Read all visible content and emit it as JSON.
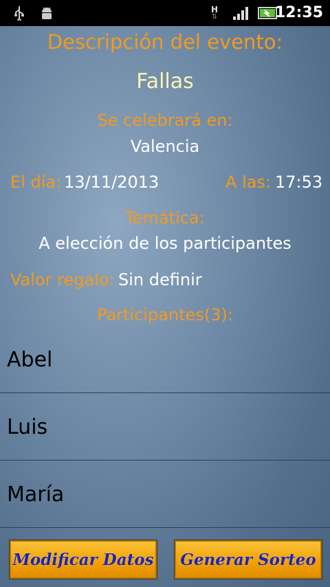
{
  "status_bar": {
    "time": "12:35",
    "network": "H",
    "icons": [
      "usb-icon",
      "android-debug-icon",
      "hspa-icon",
      "signal-icon",
      "battery-icon"
    ]
  },
  "event": {
    "heading": "Descripción del evento:",
    "name": "Fallas",
    "place_label": "Se celebrará en:",
    "place_value": "Valencia",
    "date_label": "El día:",
    "date_value": "13/11/2013",
    "time_label": "A las:",
    "time_value": "17:53",
    "theme_label": "Temática:",
    "theme_value": "A elección de los participantes",
    "gift_label": "Valor regalo:",
    "gift_value": "Sin definir",
    "participants_label": "Participantes(3):"
  },
  "participants": [
    "Abel",
    "Luis",
    "María"
  ],
  "buttons": {
    "modify": "Modificar Datos",
    "draw": "Generar Sorteo"
  },
  "colors": {
    "label": "#f39a1e",
    "event_name": "#fbf5b3",
    "button_bg": "#f4a200",
    "button_text": "#1a24b8"
  }
}
